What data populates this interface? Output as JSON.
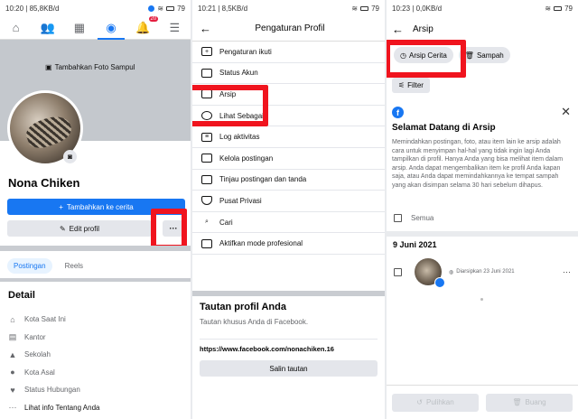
{
  "panel1": {
    "status": {
      "time": "10:20",
      "speed": "85,8KB/d",
      "battery": "79"
    },
    "tabs": {
      "notif_badge": "20"
    },
    "cover_label": "Tambahkan Foto Sampul",
    "name": "Nona Chiken",
    "add_story": "Tambahkan ke cerita",
    "edit_profile": "Edit profil",
    "more": "···",
    "tab_posts": "Postingan",
    "tab_reels": "Reels",
    "detail_title": "Detail",
    "details": [
      {
        "icon": "home-icon",
        "label": "Kota Saat Ini"
      },
      {
        "icon": "briefcase-icon",
        "label": "Kantor"
      },
      {
        "icon": "school-icon",
        "label": "Sekolah"
      },
      {
        "icon": "location-icon",
        "label": "Kota Asal"
      },
      {
        "icon": "heart-icon",
        "label": "Status Hubungan"
      },
      {
        "icon": "more-icon",
        "label": "Lihat info Tentang Anda"
      }
    ]
  },
  "panel2": {
    "status": {
      "time": "10:21",
      "speed": "8,5KB/d",
      "battery": "79"
    },
    "title": "Pengaturan Profil",
    "menu": [
      "Pengaturan ikuti",
      "Status Akun",
      "Arsip",
      "Lihat Sebagai",
      "Log aktivitas",
      "Kelola postingan",
      "Tinjau postingan dan tanda",
      "Pusat Privasi",
      "Cari",
      "Aktifkan mode profesional"
    ],
    "link_title": "Tautan profil Anda",
    "link_sub": "Tautan khusus Anda di Facebook.",
    "url": "https://www.facebook.com/nonachiken.16",
    "copy": "Salin tautan"
  },
  "panel3": {
    "status": {
      "time": "10:23",
      "speed": "0,0KB/d",
      "battery": "79"
    },
    "title": "Arsip",
    "pill_story": "Arsip Cerita",
    "pill_trash": "Sampah",
    "filter": "Filter",
    "welcome_title": "Selamat Datang di Arsip",
    "welcome_text": "Memindahkan postingan, foto, atau item lain ke arsip adalah cara untuk menyimpan hal-hal yang tidak ingin lagi Anda tampilkan di profil. Hanya Anda yang bisa melihat item dalam arsip. Anda dapat mengembalikan item ke profil Anda kapan saja, atau Anda dapat memindahkannya ke tempat sampah yang akan disimpan selama 30 hari sebelum dihapus.",
    "select_all": "Semua",
    "date": "9 Juni 2021",
    "story_meta": "Diarsipkan 23 Juni 2021",
    "restore": "Pulihkan",
    "delete": "Buang"
  },
  "colors": {
    "accent": "#1877f2",
    "highlight": "#f0141e"
  }
}
